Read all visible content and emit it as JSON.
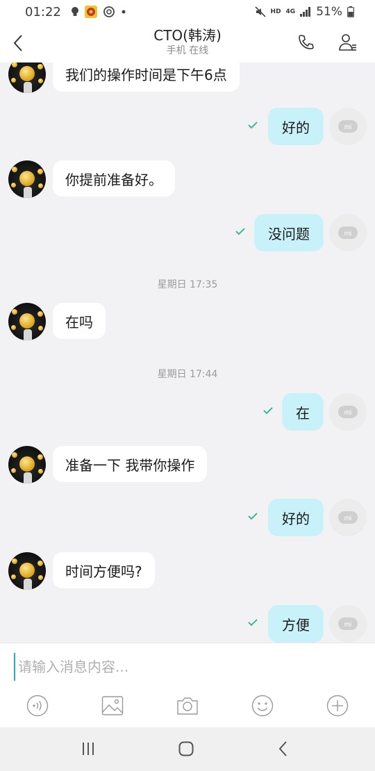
{
  "status_bar": {
    "time": "01:22",
    "network": "HD",
    "net_type": "4G",
    "battery": "51%"
  },
  "header": {
    "title": "CTO(韩涛)",
    "subtitle": "手机 在线",
    "icons": [
      "back-icon",
      "phone-icon",
      "profile-icon"
    ]
  },
  "messages": [
    {
      "direction": "in",
      "text": "我们的操作时间是下午6点"
    },
    {
      "direction": "out",
      "text": "好的",
      "read": true
    },
    {
      "direction": "in",
      "text": "你提前准备好。"
    },
    {
      "direction": "out",
      "text": "没问题",
      "read": true
    },
    {
      "type": "timestamp",
      "text": "星期日 17:35"
    },
    {
      "direction": "in",
      "text": "在吗"
    },
    {
      "type": "timestamp",
      "text": "星期日 17:44"
    },
    {
      "direction": "out",
      "text": "在",
      "read": true
    },
    {
      "direction": "in",
      "text": "准备一下 我带你操作"
    },
    {
      "direction": "out",
      "text": "好的",
      "read": true
    },
    {
      "direction": "in",
      "text": "时间方便吗?"
    },
    {
      "direction": "out",
      "text": "方便",
      "read": true
    }
  ],
  "input": {
    "placeholder": "请输入消息内容...",
    "value": ""
  },
  "toolbar": {
    "icons": [
      "voice-icon",
      "image-icon",
      "camera-icon",
      "emoji-icon",
      "plus-icon"
    ]
  },
  "nav": {
    "icons": [
      "recent-apps-icon",
      "home-icon",
      "back-nav-icon"
    ]
  },
  "colors": {
    "outgoing_bubble": "#c9f1f9",
    "incoming_bubble": "#ffffff",
    "chat_background": "#f2f2f4",
    "read_check": "#3cb89a"
  }
}
